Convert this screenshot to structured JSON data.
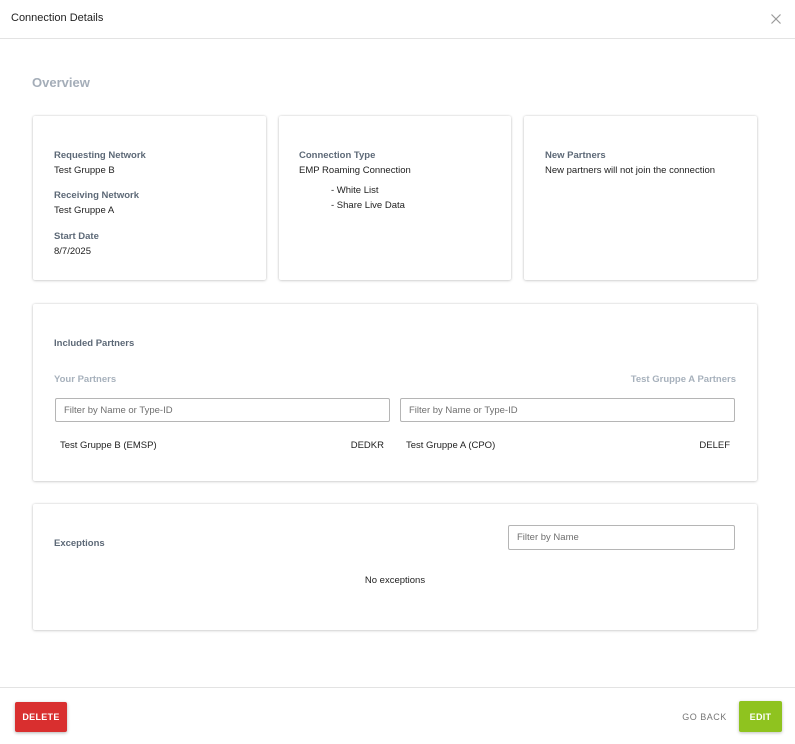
{
  "dialog": {
    "title": "Connection Details"
  },
  "overview": {
    "title": "Overview",
    "requesting_network": {
      "label": "Requesting Network",
      "value": "Test Gruppe B"
    },
    "receiving_network": {
      "label": "Receiving Network",
      "value": "Test Gruppe A"
    },
    "start_date": {
      "label": "Start Date",
      "value": "8/7/2025"
    },
    "connection_type": {
      "label": "Connection Type",
      "value": "EMP Roaming Connection",
      "options": [
        "- White List",
        "- Share Live Data"
      ]
    },
    "new_partners": {
      "label": "New Partners",
      "value": "New partners will not join the connection"
    }
  },
  "included_partners": {
    "title": "Included Partners",
    "your_partners_label": "Your Partners",
    "their_partners_label": "Test Gruppe A Partners",
    "filter_placeholder": "Filter by Name or Type-ID",
    "your_partners": [
      {
        "name": "Test Gruppe B (EMSP)",
        "id": "DEDKR"
      }
    ],
    "their_partners": [
      {
        "name": "Test Gruppe A (CPO)",
        "id": "DELEF"
      }
    ]
  },
  "exceptions": {
    "title": "Exceptions",
    "filter_placeholder": "Filter by Name",
    "empty_text": "No exceptions"
  },
  "footer": {
    "delete_label": "DELETE",
    "back_label": "GO BACK",
    "edit_label": "EDIT"
  },
  "colors": {
    "delete": "#d92f2f",
    "edit": "#8fc31f",
    "label": "#5d6977",
    "muted": "#a7b1bc"
  }
}
